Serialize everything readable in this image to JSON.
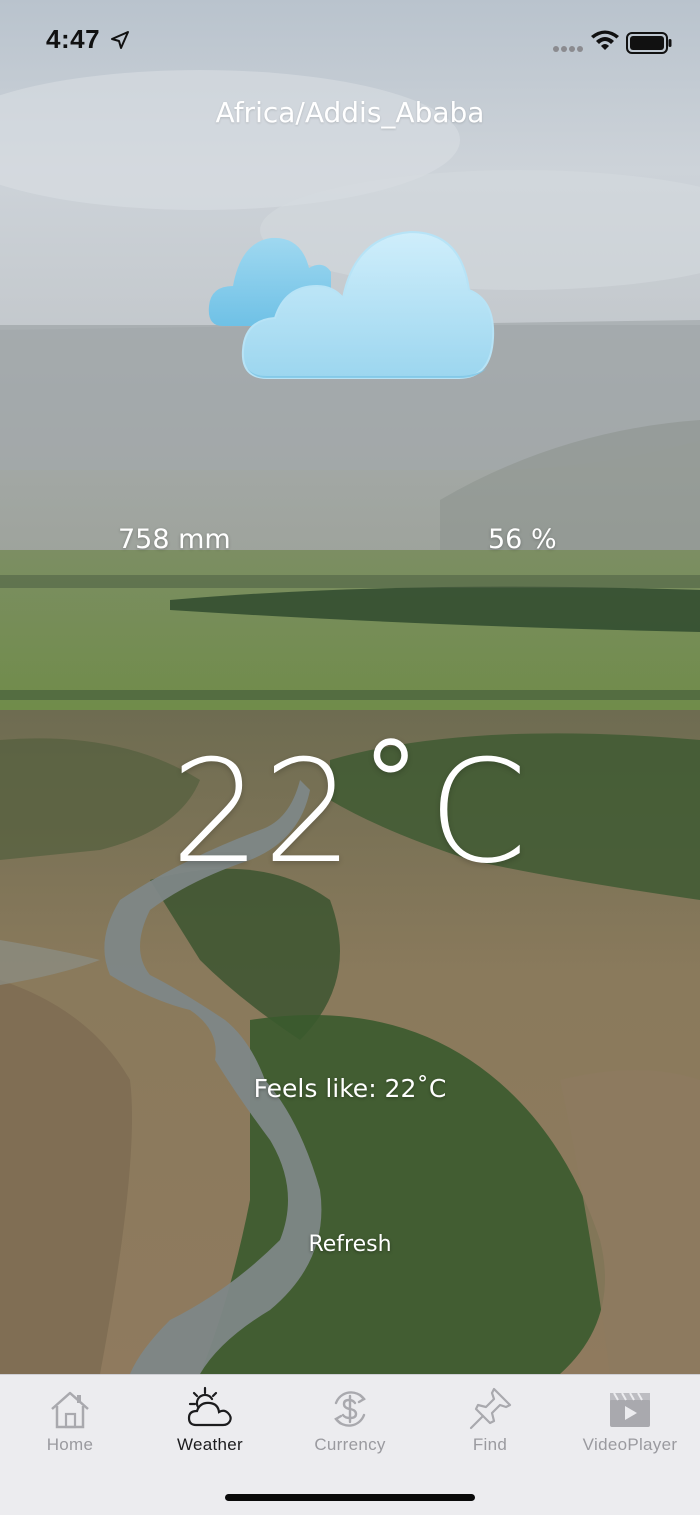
{
  "status_bar": {
    "time": "4:47",
    "icons": [
      "location-arrow-icon",
      "signal-icon",
      "wifi-icon",
      "battery-icon"
    ]
  },
  "weather": {
    "location": "Africa/Addis_Ababa",
    "condition_icon": "clouds-icon",
    "pressure": "758 mm",
    "humidity": "56 %",
    "temperature": "22˚C",
    "feels_like": "Feels like: 22˚C",
    "refresh_label": "Refresh"
  },
  "tab_bar": {
    "items": [
      {
        "label": "Home",
        "icon": "home-icon",
        "active": false
      },
      {
        "label": "Weather",
        "icon": "weather-icon",
        "active": true
      },
      {
        "label": "Currency",
        "icon": "currency-icon",
        "active": false
      },
      {
        "label": "Find",
        "icon": "pin-icon",
        "active": false
      },
      {
        "label": "VideoPlayer",
        "icon": "video-player-icon",
        "active": false
      }
    ]
  },
  "colors": {
    "tab_active": "#1c1c1e",
    "tab_inactive": "#9a9a9f",
    "tab_bar_bg": "#ececef",
    "cloud": "#a9dcf2"
  }
}
